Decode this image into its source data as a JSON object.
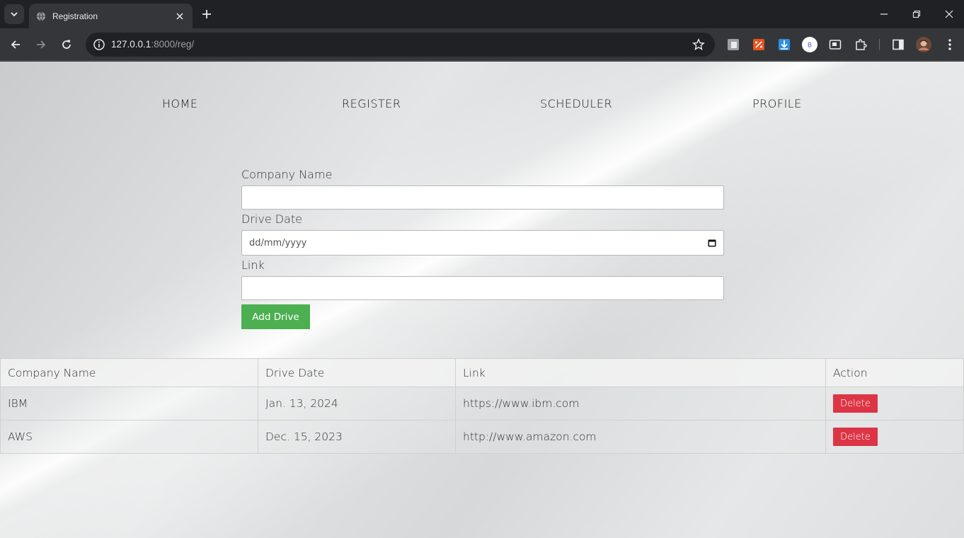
{
  "browser": {
    "tab_title": "Registration",
    "url_host": "127.0.0.1",
    "url_path": ":8000/reg/",
    "profile_badge": "B"
  },
  "nav": [
    "HOME",
    "REGISTER",
    "SCHEDULER",
    "PROFILE"
  ],
  "form": {
    "company_label": "Company Name",
    "company_value": "",
    "date_label": "Drive Date",
    "date_placeholder": "dd/mm/yyyy",
    "link_label": "Link",
    "link_value": "",
    "submit_label": "Add Drive"
  },
  "table": {
    "headers": [
      "Company Name",
      "Drive Date",
      "Link",
      "Action"
    ],
    "rows": [
      {
        "company": "IBM",
        "date": "Jan. 13, 2024",
        "link": "https://www.ibm.com",
        "action": "Delete"
      },
      {
        "company": "AWS",
        "date": "Dec. 15, 2023",
        "link": "http://www.amazon.com",
        "action": "Delete"
      }
    ]
  },
  "colors": {
    "add_button": "#4caf50",
    "delete_button": "#dc3545",
    "chrome_dark": "#202124",
    "chrome_toolbar": "#35363a"
  }
}
